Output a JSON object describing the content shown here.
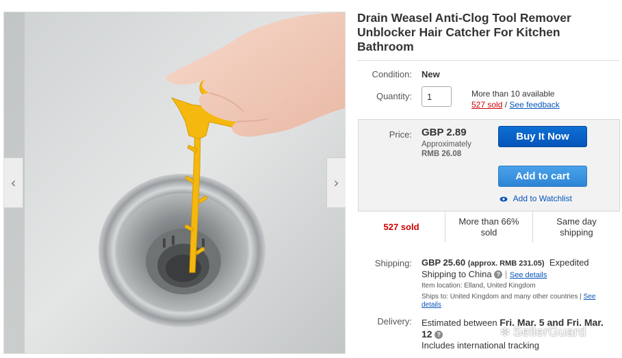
{
  "product": {
    "title": "Drain Weasel Anti-Clog Tool Remover Unblocker Hair Catcher For Kitchen Bathroom",
    "condition_label": "Condition:",
    "condition": "New",
    "quantity_label": "Quantity:",
    "quantity_value": "1",
    "availability": "More than 10 available",
    "sold_link": "527 sold",
    "separator": "/",
    "feedback_link": "See feedback"
  },
  "purchase": {
    "price_label": "Price:",
    "price": "GBP 2.89",
    "approx_label": "Approximately",
    "approx_value": "RMB 26.08",
    "buy_now": "Buy It Now",
    "add_to_cart": "Add to cart",
    "watchlist": "Add to Watchlist"
  },
  "stats": {
    "sold": "527 sold",
    "percent_sold": "More than 66% sold",
    "same_day": "Same day shipping"
  },
  "shipping": {
    "label": "Shipping:",
    "price": "GBP 25.60",
    "approx": "(approx. RMB 231.05)",
    "method": "Expedited",
    "destination": "Shipping to China",
    "see_details": "See details",
    "item_location": "Item location:  Elland, United Kingdom",
    "ships_to": "Ships to:  United Kingdom and many other countries |",
    "see_details_2": "See details"
  },
  "delivery": {
    "label": "Delivery:",
    "estimated": "Estimated between",
    "dates": "Fri. Mar. 5 and Fri. Mar. 12",
    "tracking": "Includes international tracking"
  },
  "watermark": {
    "text": "SellerGuard"
  },
  "image_nav": {
    "prev_icon": "chevron-left-icon",
    "next_icon": "chevron-right-icon"
  },
  "colors": {
    "buy_button": "#0654ba",
    "cart_button": "#3a93e0",
    "sold_red": "#cc0000",
    "link_blue": "#0654ba"
  }
}
